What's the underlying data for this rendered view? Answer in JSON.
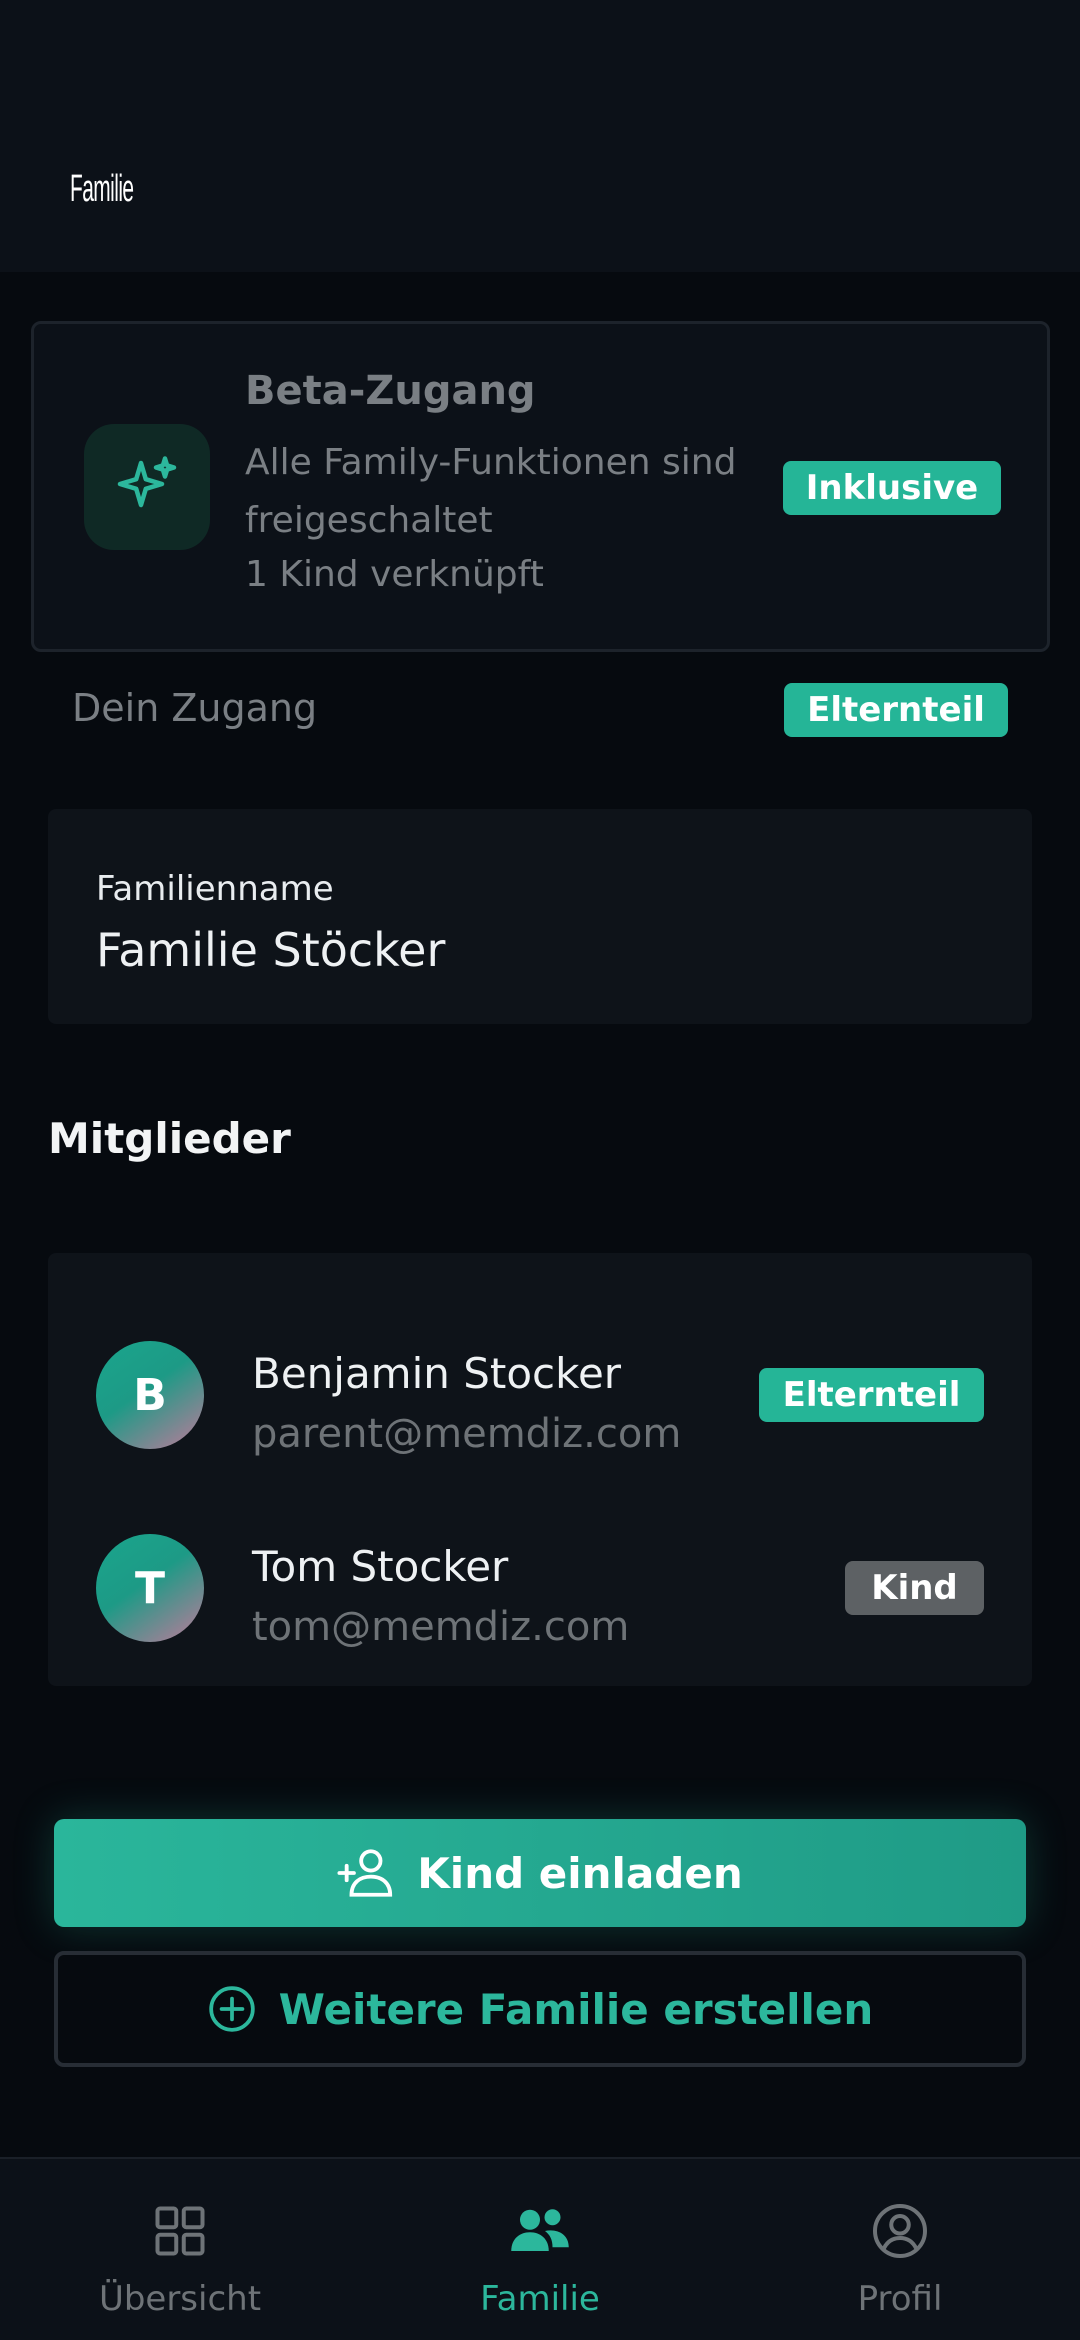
{
  "header": {
    "title": "Familie"
  },
  "beta": {
    "title": "Beta-Zugang",
    "description": "Alle Family-Funktionen sind freigeschaltet",
    "kids": "1 Kind verknüpft",
    "badge": "Inklusive",
    "icon": "sparkles-icon"
  },
  "access": {
    "label": "Dein Zugang",
    "role": "Elternteil"
  },
  "family": {
    "label": "Familienname",
    "value": "Familie Stöcker"
  },
  "members": {
    "title": "Mitglieder",
    "items": [
      {
        "initial": "B",
        "name": "Benjamin Stocker",
        "email": "parent@memdiz.com",
        "role": "Elternteil"
      },
      {
        "initial": "T",
        "name": "Tom Stocker",
        "email": "tom@memdiz.com",
        "role": "Kind"
      }
    ]
  },
  "actions": {
    "invite": "Kind einladen",
    "create": "Weitere Familie erstellen"
  },
  "nav": {
    "items": [
      {
        "label": "Übersicht",
        "icon": "grid-icon"
      },
      {
        "label": "Familie",
        "icon": "users-icon",
        "active": true
      },
      {
        "label": "Profil",
        "icon": "user-circle-icon"
      }
    ]
  },
  "colors": {
    "accent": "#25b597",
    "background": "#060a0f",
    "surface": "#0e1319",
    "muted": "#7a7f84",
    "kind_badge": "#5d6164"
  }
}
